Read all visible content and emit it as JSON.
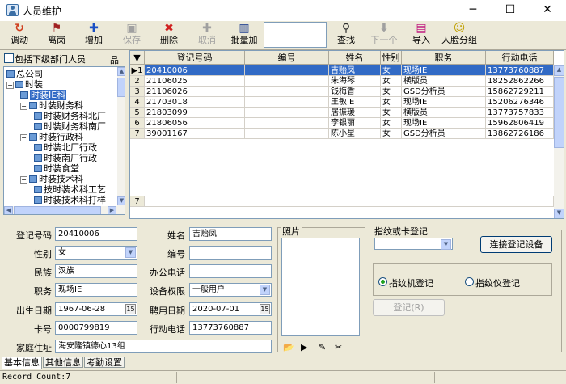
{
  "window": {
    "title": "人员维护",
    "minimize": "─",
    "maximize": "☐",
    "close": "✕"
  },
  "toolbar": {
    "buttons": [
      {
        "id": "transfer",
        "label": "调动",
        "icon": "↻",
        "color": "#d04020",
        "disabled": false
      },
      {
        "id": "leave",
        "label": "离岗",
        "icon": "⚑",
        "color": "#a02020",
        "disabled": false
      },
      {
        "id": "add",
        "label": "增加",
        "icon": "✚",
        "color": "#1a4fc4",
        "disabled": false
      },
      {
        "id": "save",
        "label": "保存",
        "icon": "▣",
        "color": "#a0a0a0",
        "disabled": true
      },
      {
        "id": "delete",
        "label": "删除",
        "icon": "✖",
        "color": "#d02020",
        "disabled": false
      },
      {
        "id": "cancel",
        "label": "取消",
        "icon": "✚",
        "color": "#a0a0a0",
        "disabled": true
      },
      {
        "id": "batch_add",
        "label": "批量加",
        "icon": "▥",
        "color": "#204090",
        "disabled": false
      },
      {
        "id": "find",
        "label": "查找",
        "icon": "⚲",
        "color": "#303030",
        "disabled": false
      },
      {
        "id": "next",
        "label": "下一个",
        "icon": "⬇",
        "color": "#a0a0a0",
        "disabled": true
      },
      {
        "id": "import",
        "label": "导入",
        "icon": "▤",
        "color": "#c02080",
        "disabled": false
      },
      {
        "id": "face_group",
        "label": "人脸分组",
        "icon": "☺",
        "color": "#c0a000",
        "disabled": false
      }
    ],
    "search_value": ""
  },
  "left": {
    "include_sub_label": "包括下级部门人员",
    "tool_icon": "品"
  },
  "tree": [
    {
      "label": "总公司",
      "level": 0,
      "exp": ""
    },
    {
      "label": "时装",
      "level": 0,
      "exp": "⊟"
    },
    {
      "label": "时装IE科",
      "level": 1,
      "exp": "",
      "sel": true
    },
    {
      "label": "时装财务科",
      "level": 1,
      "exp": "⊟"
    },
    {
      "label": "时装财务科北厂",
      "level": 2,
      "exp": ""
    },
    {
      "label": "时装财务科南厂",
      "level": 2,
      "exp": ""
    },
    {
      "label": "时装行政科",
      "level": 1,
      "exp": "⊟"
    },
    {
      "label": "时装北厂行政",
      "level": 2,
      "exp": ""
    },
    {
      "label": "时装南厂行政",
      "level": 2,
      "exp": ""
    },
    {
      "label": "时装食堂",
      "level": 2,
      "exp": ""
    },
    {
      "label": "时装技术科",
      "level": 1,
      "exp": "⊟"
    },
    {
      "label": "技时装术科工艺",
      "level": 2,
      "exp": ""
    },
    {
      "label": "时装技术科打样",
      "level": 2,
      "exp": ""
    }
  ],
  "grid": {
    "columns": [
      "",
      "登记号码",
      "编号",
      "姓名",
      "性别",
      "职务",
      "行动电话"
    ],
    "rows": [
      {
        "n": "1",
        "reg": "20410006",
        "no": "",
        "name": "吉贻凤",
        "sex": "女",
        "job": "现场IE",
        "phone": "13773760887"
      },
      {
        "n": "2",
        "reg": "21106025",
        "no": "",
        "name": "朱海琴",
        "sex": "女",
        "job": "横版员",
        "phone": "18252862266"
      },
      {
        "n": "3",
        "reg": "21106026",
        "no": "",
        "name": "钱梅香",
        "sex": "女",
        "job": "GSD分析员",
        "phone": "15862729211"
      },
      {
        "n": "4",
        "reg": "21703018",
        "no": "",
        "name": "王敏IE",
        "sex": "女",
        "job": "现场IE",
        "phone": "15206276346"
      },
      {
        "n": "5",
        "reg": "21803099",
        "no": "",
        "name": "居振瑗",
        "sex": "女",
        "job": "横版员",
        "phone": "13773757833"
      },
      {
        "n": "6",
        "reg": "21806056",
        "no": "",
        "name": "李银丽",
        "sex": "女",
        "job": "现场IE",
        "phone": "15962806419"
      },
      {
        "n": "7",
        "reg": "39001167",
        "no": "",
        "name": "陈小星",
        "sex": "女",
        "job": "GSD分析员",
        "phone": "13862726186"
      }
    ],
    "blank_row": "7"
  },
  "form": {
    "reg_label": "登记号码",
    "reg": "20410006",
    "sex_label": "性别",
    "sex": "女",
    "nation_label": "民族",
    "nation": "汉族",
    "job_label": "职务",
    "job": "现场IE",
    "birth_label": "出生日期",
    "birth": "1967-06-28",
    "card_label": "卡号",
    "card": "0000799819",
    "addr_label": "家庭住址",
    "addr": "海安隆镇德心13组",
    "name_label": "姓名",
    "name": "吉贻凤",
    "no_label": "编号",
    "no": "",
    "office_label": "办公电话",
    "office": "",
    "perm_label": "设备权限",
    "perm": "一般用户",
    "hire_label": "聘用日期",
    "hire": "2020-07-01",
    "mobile_label": "行动电话",
    "mobile": "13773760887",
    "cal_icon": "15",
    "dd_icon": "▼"
  },
  "photo": {
    "label": "照片",
    "icons": [
      "📂",
      "▶",
      "✎",
      "✂"
    ]
  },
  "fingerprint": {
    "group_label": "指纹或卡登记",
    "connect_label": "连接登记设备",
    "radio1": "指纹机登记",
    "radio2": "指纹仪登记",
    "register_label": "登记(R)"
  },
  "tabs": [
    "基本信息",
    "其他信息",
    "考勤设置"
  ],
  "status": {
    "text": "Record Count:7"
  }
}
